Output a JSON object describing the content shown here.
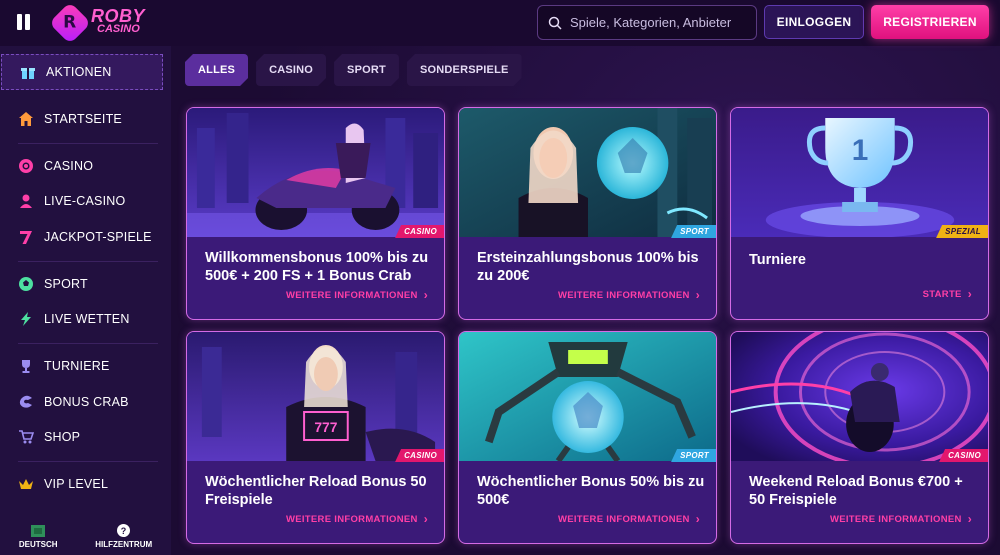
{
  "header": {
    "logo_line1": "ROBY",
    "logo_line2": "CASINO",
    "search_placeholder": "Spiele, Kategorien, Anbieter",
    "login_label": "EINLOGGEN",
    "register_label": "REGISTRIEREN"
  },
  "sidebar": {
    "items": [
      {
        "label": "AKTIONEN",
        "icon": "gift-icon"
      },
      {
        "label": "STARTSEITE",
        "icon": "home-icon"
      },
      {
        "label": "CASINO",
        "icon": "chip-icon"
      },
      {
        "label": "LIVE-CASINO",
        "icon": "dealer-icon"
      },
      {
        "label": "JACKPOT-SPIELE",
        "icon": "seven-icon"
      },
      {
        "label": "SPORT",
        "icon": "football-icon"
      },
      {
        "label": "LIVE WETTEN",
        "icon": "lightning-icon"
      },
      {
        "label": "TURNIERE",
        "icon": "trophy-icon"
      },
      {
        "label": "BONUS CRAB",
        "icon": "crab-icon"
      },
      {
        "label": "SHOP",
        "icon": "cart-icon"
      },
      {
        "label": "VIP LEVEL",
        "icon": "crown-icon"
      }
    ],
    "footer": {
      "language": "DEUTSCH",
      "help": "HILFZENTRUM"
    }
  },
  "tabs": [
    "ALLES",
    "CASINO",
    "SPORT",
    "SONDERSPIELE"
  ],
  "cards": [
    {
      "title": "Willkommensbonus 100% bis zu 500€ + 200 FS + 1 Bonus Crab",
      "badge": "CASINO",
      "link": "WEITERE INFORMATIONEN"
    },
    {
      "title": "Ersteinzahlungsbonus 100% bis zu 200€",
      "badge": "SPORT",
      "link": "WEITERE INFORMATIONEN"
    },
    {
      "title": "Turniere",
      "badge": "SPEZIAL",
      "link": "STARTE"
    },
    {
      "title": "Wöchentlicher Reload Bonus 50 Freispiele",
      "badge": "CASINO",
      "link": "WEITERE INFORMATIONEN"
    },
    {
      "title": "Wöchentlicher Bonus 50% bis zu 500€",
      "badge": "SPORT",
      "link": "WEITERE INFORMATIONEN"
    },
    {
      "title": "Weekend Reload Bonus €700 + 50 Freispiele",
      "badge": "CASINO",
      "link": "WEITERE INFORMATIONEN"
    }
  ],
  "colors": {
    "accent_pink": "#ff3fa8",
    "card_border": "#d46be6",
    "sidebar_bg": "#22103f",
    "card_bg": "#3b1a78"
  }
}
